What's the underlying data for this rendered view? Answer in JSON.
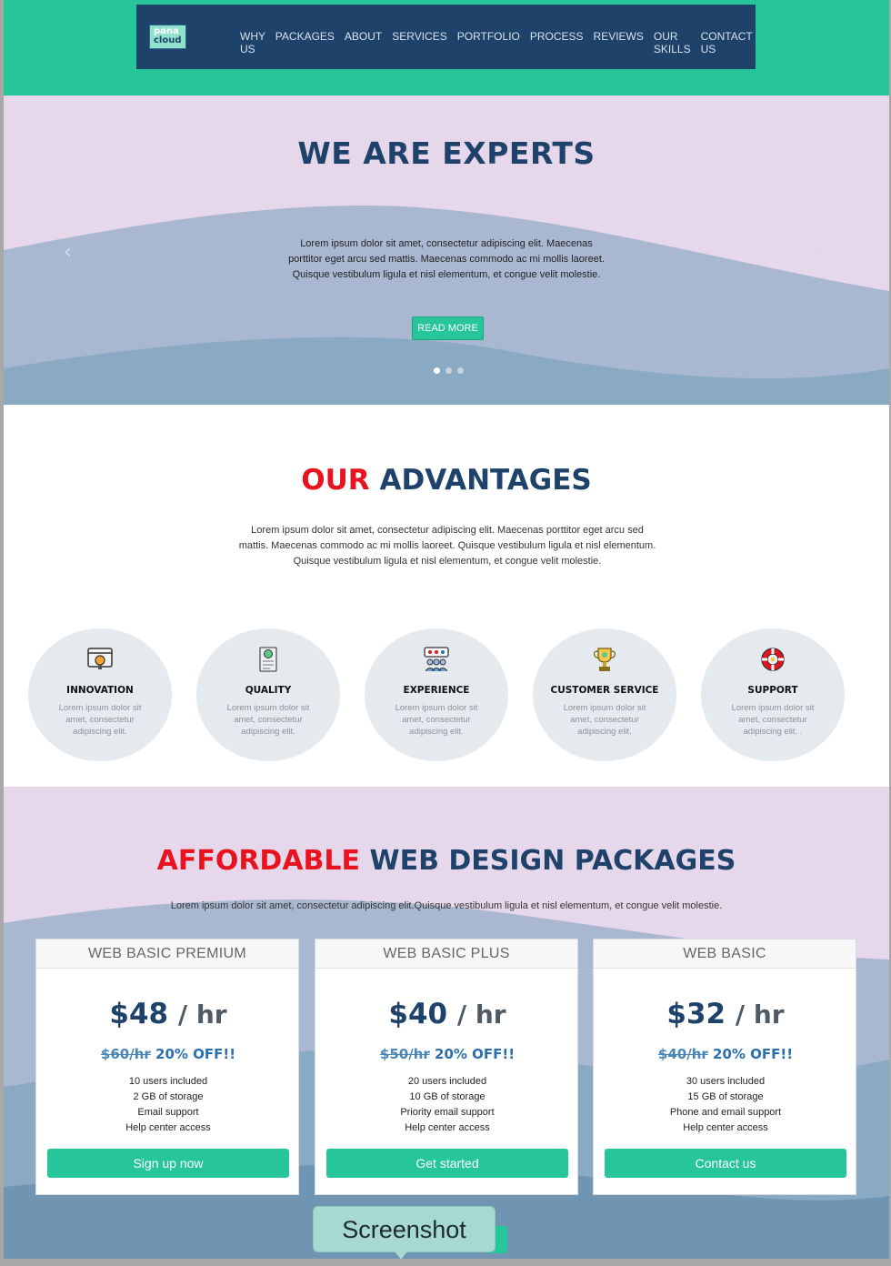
{
  "header": {
    "logo_line1": "pana",
    "logo_line2": "cloud",
    "nav": [
      "WHY US",
      "PACKAGES",
      "ABOUT",
      "SERVICES",
      "PORTFOLIO",
      "PROCESS",
      "REVIEWS",
      "OUR SKILLS",
      "CONTACT US"
    ]
  },
  "hero": {
    "title": "WE ARE EXPERTS",
    "text": "Lorem ipsum dolor sit amet, consectetur adipiscing elit. Maecenas porttitor eget arcu sed mattis. Maecenas commodo ac mi mollis laoreet. Quisque vestibulum ligula et nisl elementum, et congue velit molestie.",
    "button": "READ MORE",
    "prev_icon": "chevron-left-icon",
    "next_icon": "chevron-right-icon",
    "slides": 3,
    "active_slide": 1
  },
  "advantages": {
    "title_red": "OUR",
    "title_blue": "ADVANTAGES",
    "text": "Lorem ipsum dolor sit amet, consectetur adipiscing elit. Maecenas porttitor eget arcu sed mattis. Maecenas commodo ac mi mollis laoreet. Quisque vestibulum ligula et nisl elementum. Quisque vestibulum ligula et nisl elementum, et congue velit molestie.",
    "items": [
      {
        "title": "INNOVATION",
        "desc": "Lorem ipsum dolor sit amet, consectetur adipiscing elit.",
        "icon": "lightbulb-icon"
      },
      {
        "title": "QUALITY",
        "desc": "Lorem ipsum dolor sit amet, consectetur adipiscing elit.",
        "icon": "certificate-icon"
      },
      {
        "title": "EXPERIENCE",
        "desc": "Lorem ipsum dolor sit amet, consectetur adipiscing elit.",
        "icon": "team-rating-icon"
      },
      {
        "title": "CUSTOMER SERVICE",
        "desc": "Lorem ipsum dolor sit amet, consectetur adipiscing elit.",
        "icon": "trophy-icon"
      },
      {
        "title": "SUPPORT",
        "desc": "Lorem ipsum dolor sit amet, consectetur adipiscing elit. .",
        "icon": "lifebuoy-icon"
      }
    ]
  },
  "packages": {
    "title_red": "AFFORDABLE",
    "title_blue": "WEB DESIGN PACKAGES",
    "text": "Lorem ipsum dolor sit amet, consectetur adipiscing elit.Quisque vestibulum ligula et nisl elementum, et congue velit molestie.",
    "plans": [
      {
        "name": "WEB BASIC PREMIUM",
        "price": "$48",
        "per": "/ hr",
        "old_price": "$60/hr",
        "off": "20% OFF!!",
        "features": [
          "10 users included",
          "2 GB of storage",
          "Email support",
          "Help center access"
        ],
        "button": "Sign up now"
      },
      {
        "name": "WEB BASIC PLUS",
        "price": "$40",
        "per": "/ hr",
        "old_price": "$50/hr",
        "off": "20% OFF!!",
        "features": [
          "20 users included",
          "10 GB of storage",
          "Priority email support",
          "Help center access"
        ],
        "button": "Get started"
      },
      {
        "name": "WEB BASIC",
        "price": "$32",
        "per": "/ hr",
        "old_price": "$40/hr",
        "off": "20% OFF!!",
        "features": [
          "30 users included",
          "15 GB of storage",
          "Phone and email support",
          "Help center access"
        ],
        "button": "Contact us"
      }
    ]
  },
  "tooltip": {
    "label": "Screenshot"
  },
  "colors": {
    "green": "#27c59a",
    "navy": "#1e426a",
    "red": "#e8131f",
    "lavender": "#e6d8ea"
  }
}
